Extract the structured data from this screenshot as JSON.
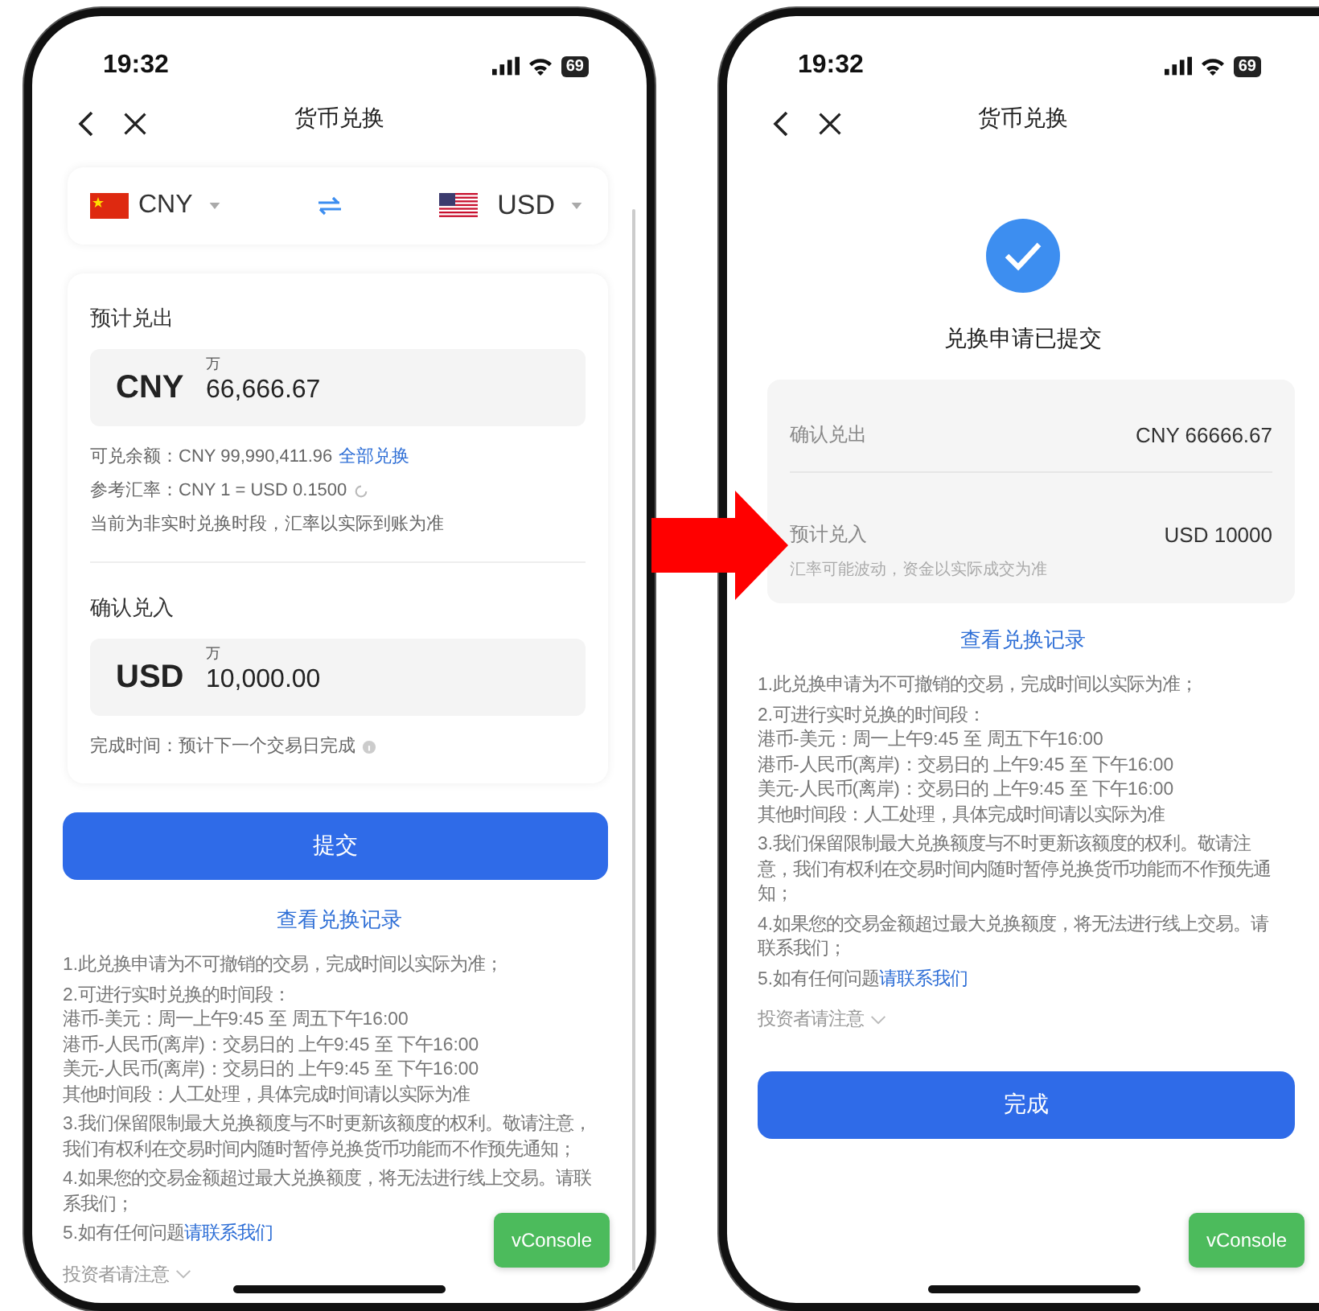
{
  "form_screen": {
    "status_bar": {
      "time": "19:32",
      "battery": "69"
    },
    "title": "货币兑换",
    "currency_bar": {
      "from": {
        "code": "CNY",
        "kind": "cn"
      },
      "to": {
        "code": "USD",
        "kind": "us"
      }
    },
    "sell": {
      "label": "预计兑出",
      "currency": "CNY",
      "unit_hint": "万",
      "amount": "66,666.67",
      "balance": "可兑余额：CNY 99,990,411.96",
      "balance_link": "全部兑换",
      "rate": "参考汇率：CNY 1 = USD 0.1500",
      "notice": "当前为非实时兑换时段，汇率以实际到账为准"
    },
    "buy": {
      "label": "确认兑入",
      "currency": "USD",
      "unit_hint": "万",
      "amount": "10,000.00",
      "completion": "完成时间：预计下一个交易日完成"
    },
    "submit_button": "提交",
    "records_link": "查看兑换记录",
    "notes": [
      {
        "lines": [
          "1.此兑换申请为不可撤销的交易，完成时间以实际为准；"
        ]
      },
      {
        "lines": [
          "2.可进行实时兑换的时间段：",
          "港币-美元：周一上午9:45 至 周五下午16:00",
          "港币-人民币(离岸)：交易日的 上午9:45 至 下午16:00",
          "美元-人民币(离岸)：交易日的 上午9:45 至 下午16:00",
          "其他时间段：人工处理，具体完成时间请以实际为准"
        ]
      },
      {
        "lines": [
          "3.我们保留限制最大兑换额度与不时更新该额度的权利。敬请注意，我们有权利在交易时间内随时暂停兑换货币功能而不作预先通知；"
        ]
      },
      {
        "lines": [
          "4.如果您的交易金额超过最大兑换额度，将无法进行线上交易。请联系我们；"
        ]
      },
      {
        "lines": [
          "5.如有任何问题"
        ],
        "link": "请联系我们"
      }
    ],
    "investor_toggle": {
      "label": "投资者请注意",
      "expanded": false
    },
    "vconsole_button": "vConsole"
  },
  "result_screen": {
    "status_bar": {
      "time": "19:32",
      "battery": "69"
    },
    "title": "货币兑换",
    "heading": "兑换申请已提交",
    "summary": [
      {
        "label": "确认兑出",
        "value": "CNY 66666.67"
      },
      {
        "label": "预计兑入",
        "value": "USD 10000",
        "hint": "汇率可能波动，资金以实际成交为准"
      }
    ],
    "records_link": "查看兑换记录",
    "notes": [
      {
        "lines": [
          "1.此兑换申请为不可撤销的交易，完成时间以实际为准；"
        ]
      },
      {
        "lines": [
          "2.可进行实时兑换的时间段：",
          "港币-美元：周一上午9:45 至 周五下午16:00",
          "港币-人民币(离岸)：交易日的 上午9:45 至 下午16:00",
          "美元-人民币(离岸)：交易日的 上午9:45 至 下午16:00",
          "其他时间段：人工处理，具体完成时间请以实际为准"
        ]
      },
      {
        "lines": [
          "3.我们保留限制最大兑换额度与不时更新该额度的权利。敬请注意，我们有权利在交易时间内随时暂停兑换货币功能而不作预先通知；"
        ]
      },
      {
        "lines": [
          "4.如果您的交易金额超过最大兑换额度，将无法进行线上交易。请联系我们；"
        ]
      },
      {
        "lines": [
          "5.如有任何问题"
        ],
        "link": "请联系我们"
      }
    ],
    "investor_toggle": {
      "label": "投资者请注意",
      "expanded": false
    },
    "done_button": "完成",
    "vconsole_button": "vConsole"
  }
}
